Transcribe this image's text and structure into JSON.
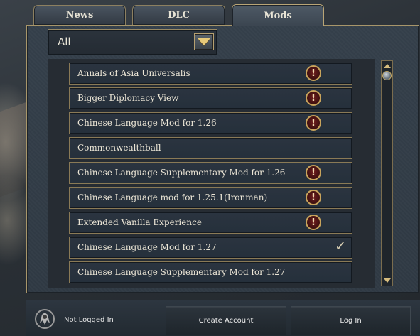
{
  "tabs": [
    {
      "label": "News",
      "active": false
    },
    {
      "label": "DLC",
      "active": false
    },
    {
      "label": "Mods",
      "active": true
    }
  ],
  "filter": {
    "selected": "All"
  },
  "mods": [
    {
      "name": "Annals of Asia Universalis",
      "status": "warning"
    },
    {
      "name": "Bigger Diplomacy View",
      "status": "warning"
    },
    {
      "name": "Chinese Language Mod for 1.26",
      "status": "warning"
    },
    {
      "name": "Commonwealthball",
      "status": "none"
    },
    {
      "name": "Chinese Language Supplementary Mod for 1.26",
      "status": "warning"
    },
    {
      "name": "Chinese Language mod for 1.25.1(Ironman)",
      "status": "warning"
    },
    {
      "name": "Extended Vanilla Experience",
      "status": "warning"
    },
    {
      "name": "Chinese Language Mod for 1.27",
      "status": "enabled"
    },
    {
      "name": "Chinese Language Supplementary Mod for 1.27",
      "status": "none"
    }
  ],
  "icons": {
    "warning": "exclamation-circle-icon",
    "enabled": "checkmark-icon",
    "dropdown": "triangle-down-icon"
  },
  "warning_glyph": "!",
  "check_glyph": "✓",
  "footer": {
    "status": "Not Logged In",
    "create_account_label": "Create Account",
    "login_label": "Log In"
  },
  "colors": {
    "accent_gold": "#b9a576",
    "warning_red": "#6e1d1d",
    "panel_bg": "#303a44"
  }
}
